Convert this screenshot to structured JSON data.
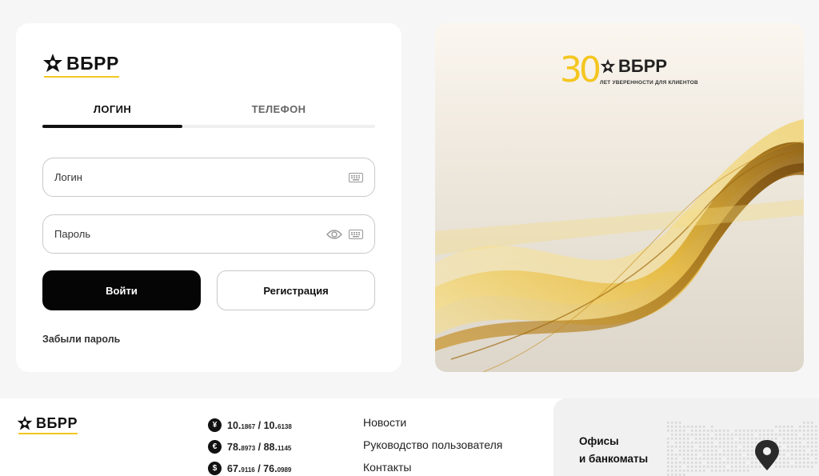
{
  "brand": {
    "name": "ВБРР",
    "accent": "#f4c61f"
  },
  "login": {
    "tabs": [
      "ЛОГИН",
      "ТЕЛЕФОН"
    ],
    "active_tab": 0,
    "login_placeholder": "Логин",
    "password_placeholder": "Пароль",
    "login_button": "Войти",
    "register_button": "Регистрация",
    "forgot_link": "Забыли пароль"
  },
  "banner": {
    "anniversary": "30",
    "tagline": "ЛЕТ УВЕРЕННОСТИ ДЛЯ КЛИЕНТОВ"
  },
  "footer": {
    "rates": [
      {
        "icon": "yuan-icon",
        "symbol": "¥",
        "buy_int": "10.",
        "buy_frac": "1867",
        "sep": " / ",
        "sell_int": "10.",
        "sell_frac": "6138"
      },
      {
        "icon": "euro-icon",
        "symbol": "€",
        "buy_int": "78.",
        "buy_frac": "8973",
        "sep": " / ",
        "sell_int": "88.",
        "sell_frac": "1145"
      },
      {
        "icon": "dollar-icon",
        "symbol": "$",
        "buy_int": "67.",
        "buy_frac": "9116",
        "sep": " / ",
        "sell_int": "76.",
        "sell_frac": "0989"
      }
    ],
    "links": [
      "Новости",
      "Руководство пользователя",
      "Контакты"
    ],
    "offices_line1": "Офисы",
    "offices_line2": "и банкоматы"
  }
}
